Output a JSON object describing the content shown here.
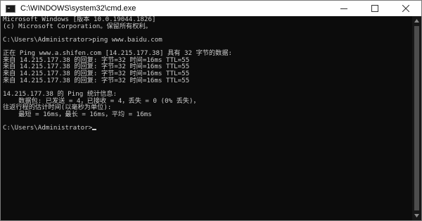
{
  "window": {
    "title": "C:\\WINDOWS\\system32\\cmd.exe"
  },
  "console": {
    "lines": [
      "Microsoft Windows [版本 10.0.19044.1826]",
      "(c) Microsoft Corporation。保留所有权利。",
      "",
      "C:\\Users\\Administrator>ping www.baidu.com",
      "",
      "正在 Ping www.a.shifen.com [14.215.177.38] 具有 32 字节的数据:",
      "来自 14.215.177.38 的回复: 字节=32 时间=16ms TTL=55",
      "来自 14.215.177.38 的回复: 字节=32 时间=16ms TTL=55",
      "来自 14.215.177.38 的回复: 字节=32 时间=16ms TTL=55",
      "来自 14.215.177.38 的回复: 字节=32 时间=16ms TTL=55",
      "",
      "14.215.177.38 的 Ping 统计信息:",
      "    数据包: 已发送 = 4，已接收 = 4，丢失 = 0 (0% 丢失)，",
      "往返行程的估计时间(以毫秒为单位):",
      "    最短 = 16ms，最长 = 16ms，平均 = 16ms",
      "",
      "C:\\Users\\Administrator>"
    ]
  },
  "colors": {
    "console_background": "#0c0c0c",
    "console_text": "#cccccc",
    "titlebar_background": "#ffffff"
  },
  "icons": {
    "app": "cmd-app-icon",
    "minimize": "minimize-icon",
    "maximize": "maximize-icon",
    "close": "close-icon",
    "scroll_up": "scroll-up-arrow-icon",
    "scroll_down": "scroll-down-arrow-icon"
  }
}
